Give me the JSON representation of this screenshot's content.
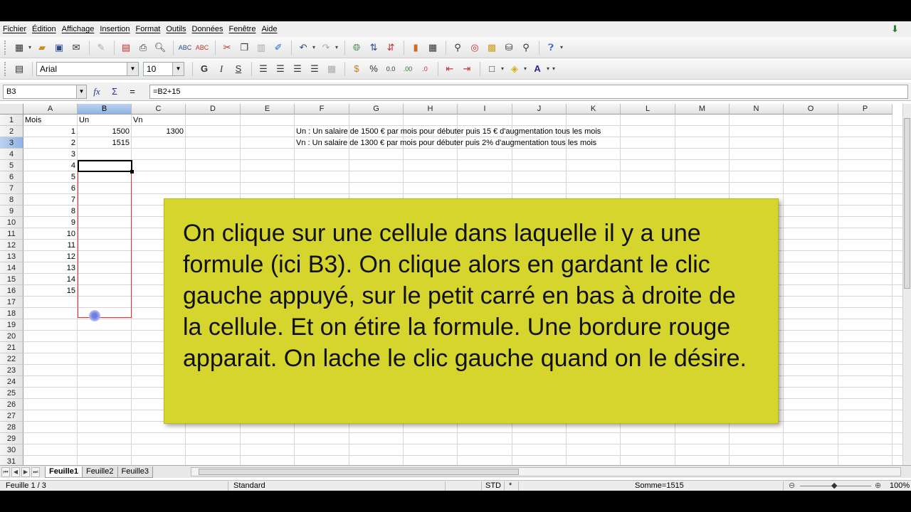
{
  "menubar": {
    "items": [
      "Fichier",
      "Édition",
      "Affichage",
      "Insertion",
      "Format",
      "Outils",
      "Données",
      "Fenêtre",
      "Aide"
    ]
  },
  "toolbar": {
    "font_name": "Arial",
    "font_size": "10"
  },
  "formula_bar": {
    "cell_ref": "B3",
    "formula": "=B2+15"
  },
  "columns": [
    "A",
    "B",
    "C",
    "D",
    "E",
    "F",
    "G",
    "H",
    "I",
    "J",
    "K",
    "L",
    "M",
    "N",
    "O",
    "P"
  ],
  "rows": [
    "1",
    "2",
    "3",
    "4",
    "5",
    "6",
    "7",
    "8",
    "9",
    "10",
    "11",
    "12",
    "13",
    "14",
    "15",
    "16",
    "17",
    "18",
    "19",
    "20",
    "21",
    "22",
    "23",
    "24",
    "25",
    "26",
    "27",
    "28",
    "29",
    "30",
    "31"
  ],
  "cells": {
    "A1": "Mois",
    "B1": "Un",
    "C1": "Vn",
    "A2": "1",
    "B2": "1500",
    "C2": "1300",
    "A3": "2",
    "B3": "1515",
    "A4": "3",
    "A5": "4",
    "A6": "5",
    "A7": "6",
    "A8": "7",
    "A9": "8",
    "A10": "9",
    "A11": "10",
    "A12": "11",
    "A13": "12",
    "A14": "13",
    "A15": "14",
    "A16": "15",
    "F2": "Un : Un salaire de 1500 € par mois pour débuter  puis 15 € d'augmentation tous les mois",
    "F3": "Vn : Un salaire de 1300 € par mois pour débuter puis 2% d'augmentation tous les mois"
  },
  "annotation": {
    "text": "On clique sur une cellule dans laquelle il y a une formule (ici B3). On clique alors en gardant le clic gauche appuyé, sur le petit carré en bas à droite de la cellule. Et on étire la formule. Une bordure rouge apparait. On lache le clic gauche quand on le désire."
  },
  "sheet_tabs": [
    "Feuille1",
    "Feuille2",
    "Feuille3"
  ],
  "status": {
    "sheet": "Feuille 1 / 3",
    "style": "Standard",
    "mode": "STD",
    "modified": "*",
    "sum": "Somme=1515",
    "zoom": "100%"
  }
}
